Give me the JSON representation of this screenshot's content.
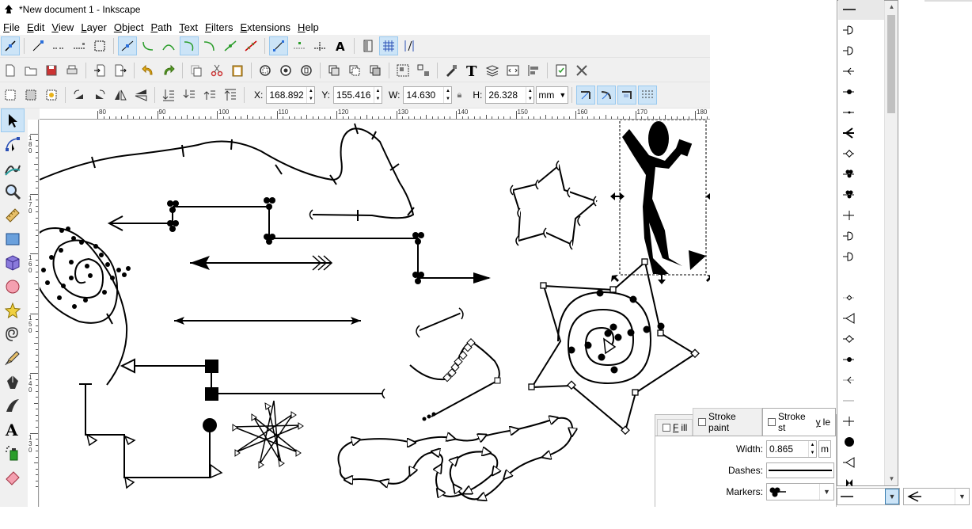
{
  "window": {
    "title": "*New document 1 - Inkscape"
  },
  "menu": [
    {
      "label": "File",
      "ul": "F",
      "rest": "ile"
    },
    {
      "label": "Edit",
      "ul": "E",
      "rest": "dit"
    },
    {
      "label": "View",
      "ul": "V",
      "rest": "iew"
    },
    {
      "label": "Layer",
      "ul": "L",
      "rest": "ayer"
    },
    {
      "label": "Object",
      "ul": "O",
      "rest": "bject"
    },
    {
      "label": "Path",
      "ul": "P",
      "rest": "ath"
    },
    {
      "label": "Text",
      "ul": "T",
      "rest": "ext"
    },
    {
      "label": "Filters",
      "ul": "F",
      "rest": "ilters"
    },
    {
      "label": "Extensions",
      "ul": "E",
      "rest": "xtensions"
    },
    {
      "label": "Help",
      "ul": "H",
      "rest": "elp"
    }
  ],
  "selection": {
    "x_label": "X:",
    "x_value": "168.892",
    "y_label": "Y:",
    "y_value": "155.416",
    "w_label": "W:",
    "w_value": "14.630",
    "h_label": "H:",
    "h_value": "26.328",
    "unit": "mm"
  },
  "ruler": {
    "h_labels": [
      "80",
      "90",
      "100",
      "110",
      "120",
      "130",
      "140",
      "150",
      "160",
      "170",
      "180"
    ],
    "v_labels": [
      "180",
      "170",
      "160",
      "150",
      "140",
      "130"
    ]
  },
  "fill_stroke": {
    "tabs": [
      {
        "label": "Fill",
        "ul": "F",
        "rest": "ill",
        "active": false
      },
      {
        "label": "Stroke paint",
        "ul": "",
        "rest": "Stroke paint",
        "active": false
      },
      {
        "label": "Stroke style",
        "ul": "y",
        "pre": "Stroke st",
        "rest": "le",
        "active": true
      }
    ],
    "width_label": "Width:",
    "width_value": "0.865",
    "width_unit": "m",
    "dashes_label": "Dashes:",
    "markers_label": "Markers:"
  },
  "colors": {
    "accent_bg": "#cce4f7",
    "accent_border": "#99c9ef",
    "toolbar_bg": "#f0f0f0"
  },
  "tools": [
    "selector-tool",
    "node-tool",
    "tweak-tool",
    "zoom-tool",
    "measure-tool",
    "rectangle-tool",
    "3d-box-tool",
    "ellipse-tool",
    "star-tool",
    "spiral-tool",
    "pencil-tool",
    "pen-tool",
    "calligraphy-tool",
    "text-tool",
    "spray-tool",
    "eraser-tool"
  ]
}
